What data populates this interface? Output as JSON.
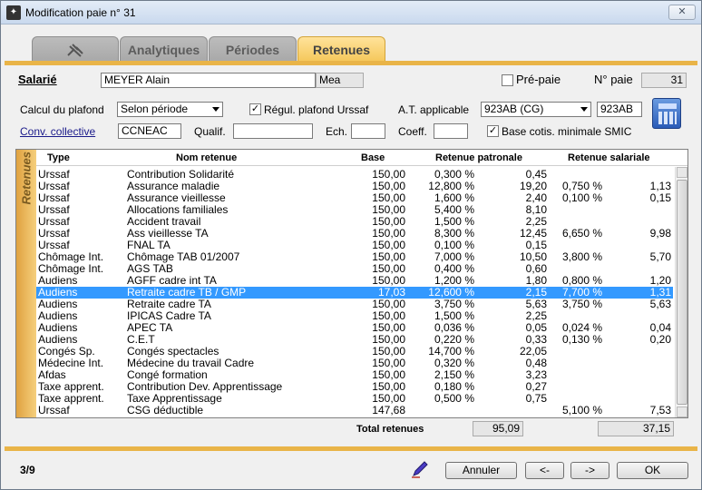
{
  "window": {
    "title": "Modification paie n° 31",
    "close_label": "✕"
  },
  "tabs": [
    {
      "label": ""
    },
    {
      "label": "Analytiques"
    },
    {
      "label": "Périodes"
    },
    {
      "label": "Retenues"
    }
  ],
  "header": {
    "salarie_label": "Salarié",
    "salarie_name": "MEYER Alain",
    "salarie_code": "Mea",
    "prepaie_label": "Pré-paie",
    "prepaie_checked": false,
    "npaie_label": "N° paie",
    "npaie_value": "31"
  },
  "form": {
    "calcul_label": "Calcul du plafond",
    "calcul_value": "Selon période",
    "regul_label": "Régul. plafond Urssaf",
    "at_label": "A.T. applicable",
    "at_value": "923AB (CG)",
    "at_code": "923AB",
    "conv_label": "Conv. collective",
    "conv_value": "CCNEAC",
    "qualif_label": "Qualif.",
    "qualif_value": "",
    "ech_label": "Ech.",
    "ech_value": "",
    "coeff_label": "Coeff.",
    "coeff_value": "",
    "base_smic_label": "Base cotis. minimale SMIC"
  },
  "grid": {
    "side_label": "Retenues",
    "columns": {
      "type": "Type",
      "name": "Nom retenue",
      "base": "Base",
      "patronale": "Retenue patronale",
      "salariale": "Retenue salariale"
    },
    "rows": [
      [
        "Urssaf",
        "Contribution Solidarité",
        "150,00",
        "0,300 %",
        "0,45",
        "",
        ""
      ],
      [
        "Urssaf",
        "Assurance maladie",
        "150,00",
        "12,800 %",
        "19,20",
        "0,750 %",
        "1,13"
      ],
      [
        "Urssaf",
        "Assurance vieillesse",
        "150,00",
        "1,600 %",
        "2,40",
        "0,100 %",
        "0,15"
      ],
      [
        "Urssaf",
        "Allocations familiales",
        "150,00",
        "5,400 %",
        "8,10",
        "",
        ""
      ],
      [
        "Urssaf",
        "Accident travail",
        "150,00",
        "1,500 %",
        "2,25",
        "",
        ""
      ],
      [
        "Urssaf",
        "Ass vieillesse TA",
        "150,00",
        "8,300 %",
        "12,45",
        "6,650 %",
        "9,98"
      ],
      [
        "Urssaf",
        "FNAL TA",
        "150,00",
        "0,100 %",
        "0,15",
        "",
        ""
      ],
      [
        "Chômage Int.",
        "Chômage TAB 01/2007",
        "150,00",
        "7,000 %",
        "10,50",
        "3,800 %",
        "5,70"
      ],
      [
        "Chômage Int.",
        "AGS TAB",
        "150,00",
        "0,400 %",
        "0,60",
        "",
        ""
      ],
      [
        "Audiens",
        "AGFF cadre int TA",
        "150,00",
        "1,200 %",
        "1,80",
        "0,800 %",
        "1,20"
      ],
      [
        "Audiens",
        "Retraite cadre TB / GMP",
        "17,03",
        "12,600 %",
        "2,15",
        "7,700 %",
        "1,31"
      ],
      [
        "Audiens",
        "Retraite cadre TA",
        "150,00",
        "3,750 %",
        "5,63",
        "3,750 %",
        "5,63"
      ],
      [
        "Audiens",
        "IPICAS Cadre TA",
        "150,00",
        "1,500 %",
        "2,25",
        "",
        ""
      ],
      [
        "Audiens",
        "APEC TA",
        "150,00",
        "0,036 %",
        "0,05",
        "0,024 %",
        "0,04"
      ],
      [
        "Audiens",
        "C.E.T",
        "150,00",
        "0,220 %",
        "0,33",
        "0,130 %",
        "0,20"
      ],
      [
        "Congés Sp.",
        "Congés spectacles",
        "150,00",
        "14,700 %",
        "22,05",
        "",
        ""
      ],
      [
        "Médecine Int.",
        "Médecine du travail Cadre",
        "150,00",
        "0,320 %",
        "0,48",
        "",
        ""
      ],
      [
        "Afdas",
        "Congé formation",
        "150,00",
        "2,150 %",
        "3,23",
        "",
        ""
      ],
      [
        "Taxe apprent.",
        "Contribution Dev. Apprentissage",
        "150,00",
        "0,180 %",
        "0,27",
        "",
        ""
      ],
      [
        "Taxe apprent.",
        "Taxe Apprentissage",
        "150,00",
        "0,500 %",
        "0,75",
        "",
        ""
      ],
      [
        "Urssaf",
        "CSG déductible",
        "147,68",
        "",
        "",
        "5,100 %",
        "7,53"
      ]
    ],
    "selected_index": 10
  },
  "totals": {
    "label": "Total retenues",
    "patronale": "95,09",
    "salariale": "37,15"
  },
  "footer": {
    "page": "3/9",
    "cancel": "Annuler",
    "prev": "<-",
    "next": "->",
    "ok": "OK"
  }
}
